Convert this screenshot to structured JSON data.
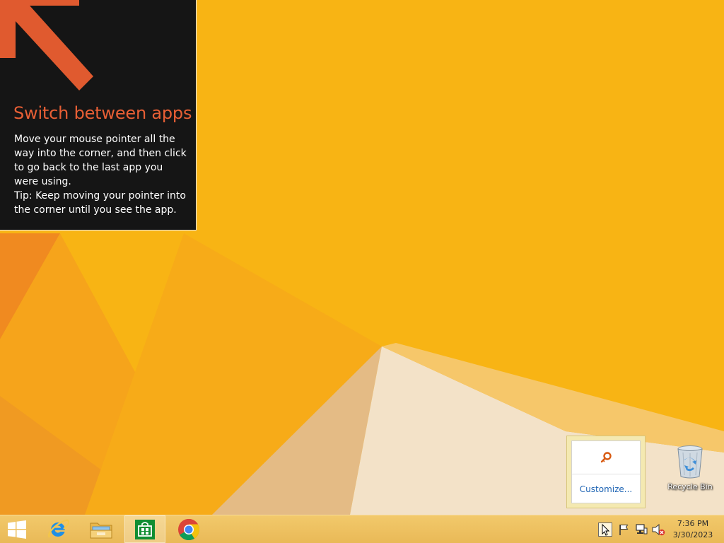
{
  "tutorial": {
    "title": "Switch between apps",
    "body_lines": [
      "Move your mouse pointer all the way into the corner, and then click to go back to the last app you were using.",
      "Tip: Keep moving your pointer into the corner until you see the app."
    ],
    "arrow_icon": "arrow-up-left-icon",
    "title_color": "#e85f35",
    "background_color": "#151515"
  },
  "desktop": {
    "wallpaper_colors": [
      "#f7b012",
      "#f39a1e",
      "#f2e0c6"
    ],
    "recycle_bin_label": "Recycle Bin",
    "recycle_bin_icon": "recycle-bin-icon"
  },
  "tray_popup": {
    "icon": "magnifier-key-icon",
    "customize_label": "Customize..."
  },
  "taskbar": {
    "pinned": [
      {
        "name": "start",
        "icon": "windows-logo-icon"
      },
      {
        "name": "internet-explorer",
        "icon": "internet-explorer-icon"
      },
      {
        "name": "file-explorer",
        "icon": "folder-icon"
      },
      {
        "name": "store",
        "icon": "store-bag-icon",
        "active": true
      },
      {
        "name": "chrome",
        "icon": "chrome-icon"
      }
    ],
    "tray": {
      "icons": [
        "show-hidden-icons-icon",
        "flag-icon",
        "network-icon",
        "volume-muted-icon"
      ],
      "time": "7:36 PM",
      "date": "3/30/2023"
    }
  }
}
